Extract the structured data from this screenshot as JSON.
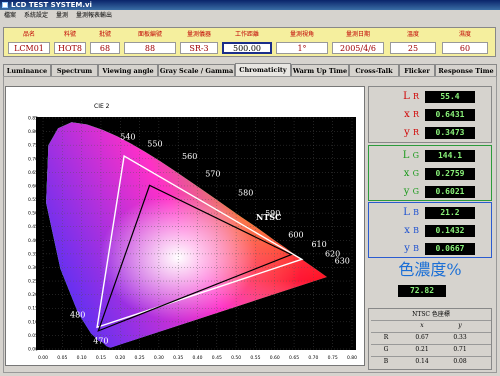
{
  "window": {
    "title": "LCD TEST SYSTEM.vi"
  },
  "menu": [
    "檔案",
    "系統設定",
    "量測",
    "量測報表輸出"
  ],
  "info": {
    "headers": [
      "品名",
      "料號",
      "批號",
      "面板編號",
      "量測儀器",
      "工作距離",
      "量測視角",
      "量測日期",
      "溫度",
      "濕度"
    ],
    "values": [
      "LCM01",
      "HOT8",
      "68",
      "88",
      "SR-3",
      "500.00",
      "1°",
      "2005/4/6",
      "25",
      "60"
    ]
  },
  "tabs": [
    "Luminance",
    "Spectrum",
    "Viewing angle",
    "Gray Scale / Gamma",
    "Chromaticity",
    "Warm Up Time",
    "Cross-Talk",
    "Flicker",
    "Response Time"
  ],
  "active_tab": "Chromaticity",
  "chart": {
    "title": "CIE 2",
    "overlay_label": "NTSC",
    "x_ticks": [
      "0.00",
      "0.05",
      "0.10",
      "0.15",
      "0.20",
      "0.25",
      "0.30",
      "0.35",
      "0.40",
      "0.45",
      "0.50",
      "0.55",
      "0.60",
      "0.65",
      "0.70",
      "0.75",
      "0.80"
    ],
    "y_ticks": [
      "0.85",
      "0.80",
      "0.75",
      "0.70",
      "0.65",
      "0.60",
      "0.55",
      "0.50",
      "0.45",
      "0.40",
      "0.35",
      "0.30",
      "0.25",
      "0.20",
      "0.15",
      "0.10",
      "0.05",
      "0.00"
    ],
    "wavelength_labels": [
      "540",
      "550",
      "560",
      "570",
      "580",
      "590",
      "600",
      "610",
      "620",
      "630",
      "480",
      "470"
    ]
  },
  "red": {
    "lum_label": "L",
    "x_label": "x",
    "y_label": "y",
    "sub": "R",
    "L": "55.4",
    "x": "0.6431",
    "y": "0.3473"
  },
  "green": {
    "lum_label": "L",
    "x_label": "x",
    "y_label": "y",
    "sub": "G",
    "L": "144.1",
    "x": "0.2759",
    "y": "0.6021"
  },
  "blue": {
    "lum_label": "L",
    "x_label": "x",
    "y_label": "y",
    "sub": "B",
    "L": "21.2",
    "x": "0.1432",
    "y": "0.0667"
  },
  "saturation": {
    "title": "色濃度%",
    "value": "72.82"
  },
  "ntsc_table": {
    "title": "NTSC 色座標",
    "headers": [
      "",
      "x",
      "y"
    ],
    "rows": [
      [
        "R",
        "0.67",
        "0.33"
      ],
      [
        "G",
        "0.21",
        "0.71"
      ],
      [
        "B",
        "0.14",
        "0.08"
      ]
    ]
  },
  "colors": {
    "measured_triangle": "#000000",
    "ntsc_triangle": "#ffffff",
    "readout_text": "#8af27a",
    "group_border": "#2c9b3c"
  }
}
